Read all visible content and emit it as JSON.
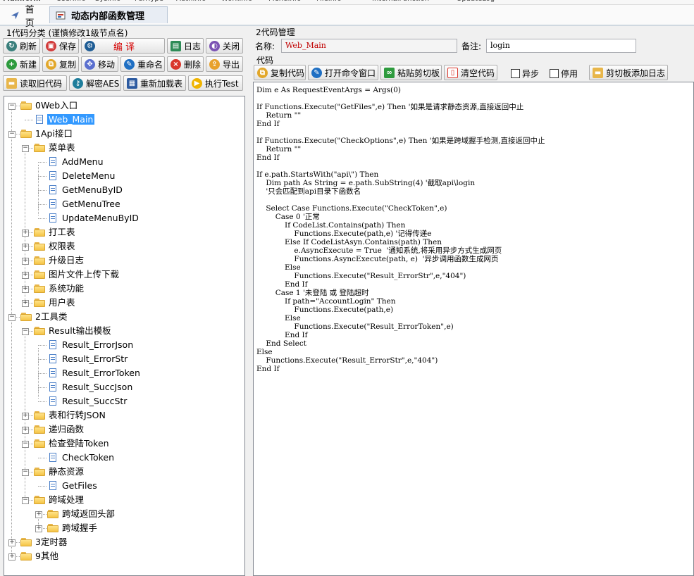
{
  "top_strip": [
    "Mainform",
    "UserInfo",
    "SysInfo",
    "FunType",
    "AuthInfo",
    "WorkInfo",
    "MenuInfo",
    "FileInfo",
    "InternalFunction",
    "UpdateLog"
  ],
  "tabs": [
    {
      "label": "首页",
      "active": false
    },
    {
      "label": "动态内部函数管理",
      "active": true
    }
  ],
  "left": {
    "title": "1代码分类  (谨慎修改1级节点名)",
    "row1": {
      "refresh": "刷新",
      "save": "保存",
      "compile": "编 译",
      "log": "日志",
      "close": "关闭"
    },
    "row2": {
      "new": "新建",
      "copy": "复制",
      "move": "移动",
      "rename": "重命名",
      "delete": "删除",
      "export": "导出"
    },
    "row3": {
      "read_old": "读取旧代码",
      "decrypt": "解密AES",
      "reload": "重新加载表",
      "run_test": "执行Test"
    }
  },
  "tree": [
    {
      "label": "0Web入口",
      "level": 0,
      "expanded": true,
      "folder": true
    },
    {
      "label": "Web_Main",
      "level": 1,
      "file": true,
      "selected": true
    },
    {
      "label": "1Api接口",
      "level": 0,
      "expanded": true,
      "folder": true
    },
    {
      "label": "菜单表",
      "level": 1,
      "expanded": true,
      "folder": true
    },
    {
      "label": "AddMenu",
      "level": 2,
      "file": true
    },
    {
      "label": "DeleteMenu",
      "level": 2,
      "file": true
    },
    {
      "label": "GetMenuByID",
      "level": 2,
      "file": true
    },
    {
      "label": "GetMenuTree",
      "level": 2,
      "file": true
    },
    {
      "label": "UpdateMenuByID",
      "level": 2,
      "file": true
    },
    {
      "label": "打工表",
      "level": 1,
      "expanded": false,
      "folder": true
    },
    {
      "label": "权限表",
      "level": 1,
      "expanded": false,
      "folder": true
    },
    {
      "label": "升级日志",
      "level": 1,
      "expanded": false,
      "folder": true
    },
    {
      "label": "图片文件上传下载",
      "level": 1,
      "expanded": false,
      "folder": true
    },
    {
      "label": "系统功能",
      "level": 1,
      "expanded": false,
      "folder": true
    },
    {
      "label": "用户表",
      "level": 1,
      "expanded": false,
      "folder": true
    },
    {
      "label": "2工具类",
      "level": 0,
      "expanded": true,
      "folder": true
    },
    {
      "label": "Result输出模板",
      "level": 1,
      "expanded": true,
      "folder": true
    },
    {
      "label": "Result_ErrorJson",
      "level": 2,
      "file": true
    },
    {
      "label": "Result_ErrorStr",
      "level": 2,
      "file": true
    },
    {
      "label": "Result_ErrorToken",
      "level": 2,
      "file": true
    },
    {
      "label": "Result_SuccJson",
      "level": 2,
      "file": true
    },
    {
      "label": "Result_SuccStr",
      "level": 2,
      "file": true
    },
    {
      "label": "表和行转JSON",
      "level": 1,
      "expanded": false,
      "folder": true
    },
    {
      "label": "递归函数",
      "level": 1,
      "expanded": false,
      "folder": true
    },
    {
      "label": "检查登陆Token",
      "level": 1,
      "expanded": true,
      "folder": true
    },
    {
      "label": "CheckToken",
      "level": 2,
      "file": true
    },
    {
      "label": "静态资源",
      "level": 1,
      "expanded": true,
      "folder": true
    },
    {
      "label": "GetFiles",
      "level": 2,
      "file": true
    },
    {
      "label": "跨域处理",
      "level": 1,
      "expanded": true,
      "folder": true
    },
    {
      "label": "跨域返回头部",
      "level": 2,
      "expanded": false,
      "folder": true
    },
    {
      "label": "跨域握手",
      "level": 2,
      "expanded": false,
      "folder": true
    },
    {
      "label": "3定时器",
      "level": 0,
      "expanded": false,
      "folder": true
    },
    {
      "label": "9其他",
      "level": 0,
      "expanded": false,
      "folder": true
    }
  ],
  "right": {
    "title": "2代码管理",
    "name_label": "名称:",
    "name_value": "Web_Main",
    "note_label": "备注:",
    "note_value": "login",
    "code_label": "代码",
    "toolbar": {
      "copy_code": "复制代码",
      "open_cmd": "打开命令窗口",
      "paste_clip": "粘贴剪切板",
      "clear_code": "清空代码",
      "async": "异步",
      "disable": "停用",
      "clip_log": "剪切板添加日志"
    },
    "async_checked": false,
    "disable_checked": false,
    "code": "Dim e As RequestEventArgs = Args(0)\n\nIf Functions.Execute(\"GetFiles\",e) Then '如果是请求静态资源,直接返回中止\n    Return \"\"\nEnd If\n\nIf Functions.Execute(\"CheckOptions\",e) Then '如果是跨域握手检测,直接返回中止\n    Return \"\"\nEnd If\n\nIf e.path.StartsWith(\"api\\\") Then\n    Dim path As String = e.path.SubString(4) '截取api\\login\n    '只会匹配到api目录下函数名\n\n    Select Case Functions.Execute(\"CheckToken\",e)\n        Case 0 '正常\n            If CodeList.Contains(path) Then\n                Functions.Execute(path,e) '记得传递e\n            Else If CodeListAsyn.Contains(path) Then\n                e.AsyncExecute = True  '通知系统,将采用异步方式生成网页\n                Functions.AsyncExecute(path, e)  '异步调用函数生成网页\n            Else\n                Functions.Execute(\"Result_ErrorStr\",e,\"404\")\n            End If\n        Case 1 '未登陆 或 登陆超时\n            If path=\"AccountLogin\" Then\n                Functions.Execute(path,e)\n            Else\n                Functions.Execute(\"Result_ErrorToken\",e)\n            End If\n    End Select\nElse\n    Functions.Execute(\"Result_ErrorStr\",e,\"404\")\nEnd If"
  },
  "colors": {
    "selection": "#3399ff",
    "name_value": "#c00000",
    "compile": "#d40000"
  }
}
